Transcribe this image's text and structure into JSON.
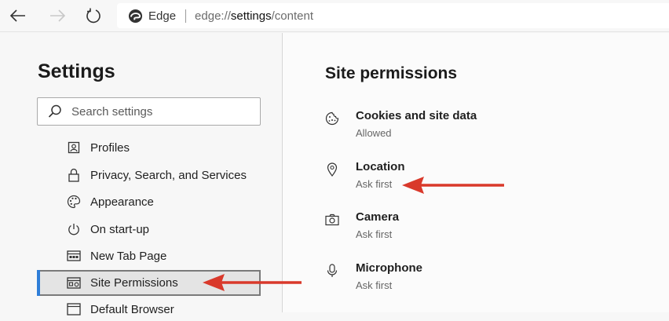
{
  "toolbar": {
    "brand": "Edge",
    "url_prefix": "edge://",
    "url_bold": "settings",
    "url_suffix": "/content"
  },
  "left": {
    "title": "Settings",
    "search_placeholder": "Search settings",
    "items": [
      {
        "label": "Profiles",
        "icon": "profile-card-icon"
      },
      {
        "label": "Privacy, Search, and Services",
        "icon": "lock-icon"
      },
      {
        "label": "Appearance",
        "icon": "palette-icon"
      },
      {
        "label": "On start-up",
        "icon": "power-icon"
      },
      {
        "label": "New Tab Page",
        "icon": "new-tab-icon"
      },
      {
        "label": "Site Permissions",
        "icon": "site-permissions-icon",
        "selected": true
      },
      {
        "label": "Default Browser",
        "icon": "browser-window-icon"
      }
    ]
  },
  "right": {
    "title": "Site permissions",
    "permissions": [
      {
        "name": "Cookies and site data",
        "status": "Allowed",
        "icon": "cookie-icon"
      },
      {
        "name": "Location",
        "status": "Ask first",
        "icon": "location-pin-icon"
      },
      {
        "name": "Camera",
        "status": "Ask first",
        "icon": "camera-icon"
      },
      {
        "name": "Microphone",
        "status": "Ask first",
        "icon": "microphone-icon"
      }
    ]
  },
  "colors": {
    "accent": "#2f7ed8",
    "annotation_arrow": "#d9392b"
  }
}
